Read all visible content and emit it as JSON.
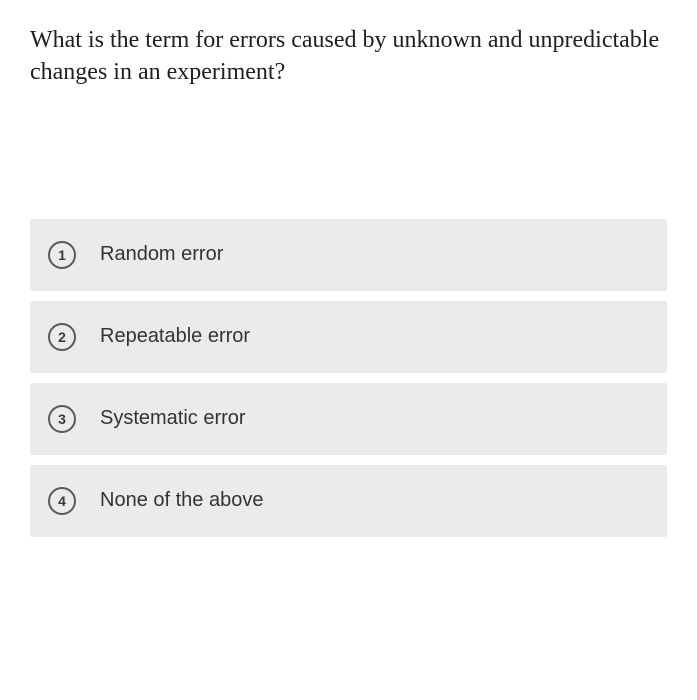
{
  "question": "What is the term for errors caused by unknown and unpredictable changes in an experiment?",
  "options": [
    {
      "number": "1",
      "label": "Random error"
    },
    {
      "number": "2",
      "label": "Repeatable error"
    },
    {
      "number": "3",
      "label": "Systematic error"
    },
    {
      "number": "4",
      "label": "None of the above"
    }
  ]
}
